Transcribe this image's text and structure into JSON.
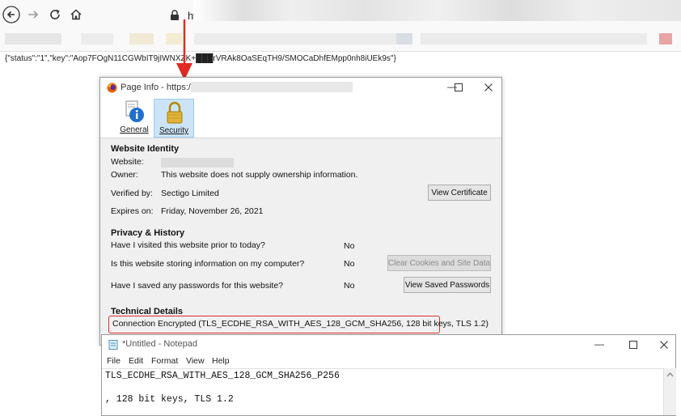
{
  "browser": {
    "url_prefix": "htt",
    "back_icon": "back-arrow-icon",
    "forward_icon": "forward-arrow-icon",
    "reload_icon": "reload-icon",
    "home_icon": "home-icon",
    "lock_icon": "lock-icon"
  },
  "page": {
    "json_text": "{\"status\":\"1\",\"key\":\"Aop7FOgN11CGWbIT9jIWNXZK+███rVRAk8OaSEqTH9/SMOCaDhfEMpp0nh8iUEk9s\"}"
  },
  "annotation": {
    "color": "#d9302c"
  },
  "page_info": {
    "title_prefix": "Page Info - https://",
    "tabs": [
      {
        "label": "General",
        "icon": "info-icon"
      },
      {
        "label": "Security",
        "icon": "padlock-icon"
      }
    ],
    "identity": {
      "heading": "Website Identity",
      "website_label": "Website:",
      "owner_label": "Owner:",
      "owner_value": "This website does not supply ownership information.",
      "verified_label": "Verified by:",
      "verified_value": "Sectigo Limited",
      "expires_label": "Expires on:",
      "expires_value": "Friday, November 26, 2021",
      "view_cert_button": "View Certificate"
    },
    "privacy": {
      "heading": "Privacy & History",
      "q1": "Have I visited this website prior to today?",
      "a1": "No",
      "q2": "Is this website storing information on my computer?",
      "a2": "No",
      "clear_button": "Clear Cookies and Site Data",
      "q3": "Have I saved any passwords for this website?",
      "a3": "No",
      "passwords_button": "View Saved Passwords"
    },
    "technical": {
      "heading": "Technical Details",
      "connection": "Connection Encrypted (TLS_ECDHE_RSA_WITH_AES_128_GCM_SHA256, 128 bit keys, TLS 1.2)"
    }
  },
  "notepad": {
    "title": "*Untitled - Notepad",
    "menu": [
      "File",
      "Edit",
      "Format",
      "View",
      "Help"
    ],
    "lines": [
      "TLS_ECDHE_RSA_WITH_AES_128_GCM_SHA256_P256",
      "",
      ", 128 bit keys, TLS 1.2"
    ]
  }
}
